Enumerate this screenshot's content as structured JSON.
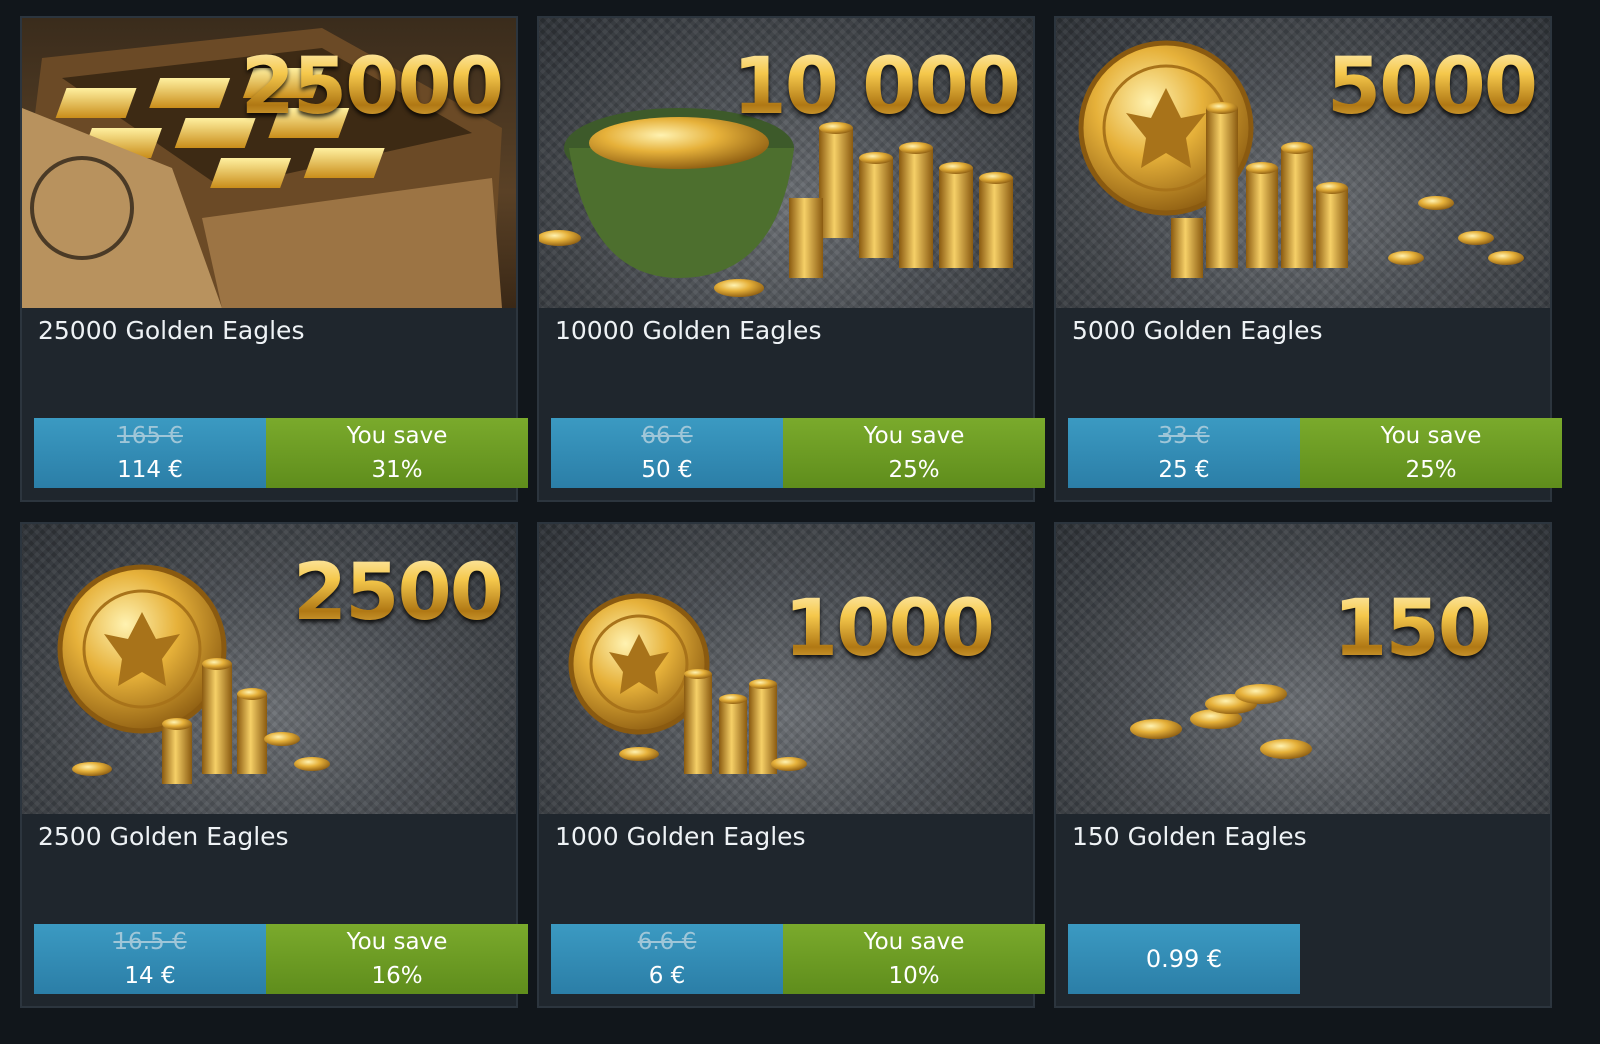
{
  "currency_name": "Golden Eagles",
  "colors": {
    "price_blue": "#2e86b0",
    "save_green": "#6c9a22",
    "card_bg": "#1f262d",
    "gold": "#e8b23c"
  },
  "cards": [
    {
      "amount_display": "25000",
      "title": "25000 Golden Eagles",
      "old_price": "165 €",
      "price": "114 €",
      "save_label": "You save",
      "save_percent": "31%"
    },
    {
      "amount_display": "10 000",
      "title": "10000 Golden Eagles",
      "old_price": "66 €",
      "price": "50 €",
      "save_label": "You save",
      "save_percent": "25%"
    },
    {
      "amount_display": "5000",
      "title": "5000 Golden Eagles",
      "old_price": "33 €",
      "price": "25 €",
      "save_label": "You save",
      "save_percent": "25%"
    },
    {
      "amount_display": "2500",
      "title": "2500 Golden Eagles",
      "old_price": "16.5 €",
      "price": "14 €",
      "save_label": "You save",
      "save_percent": "16%"
    },
    {
      "amount_display": "1000",
      "title": "1000 Golden Eagles",
      "old_price": "6.6 €",
      "price": "6 €",
      "save_label": "You save",
      "save_percent": "10%"
    },
    {
      "amount_display": "150",
      "title": "150 Golden Eagles",
      "price": "0.99 €"
    }
  ]
}
